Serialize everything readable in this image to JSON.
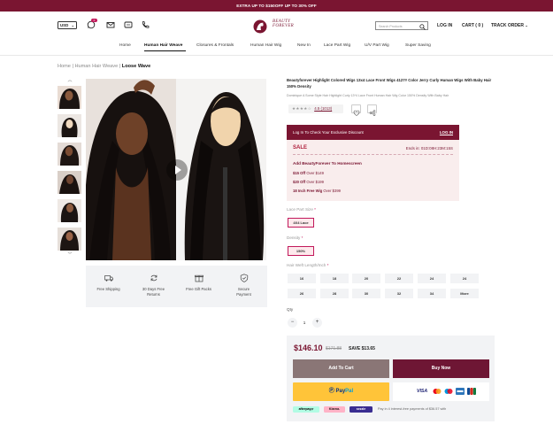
{
  "promo": "EXTRA UP TO $150OFF UP TO 30% OFF",
  "header": {
    "currency": "USD",
    "wishlist_count": "0",
    "logo_line1": "BEAUTY",
    "logo_line2": "FOREVER",
    "search_placeholder": "Search Products",
    "login": "LOG IN",
    "cart": "CART ( 0 )",
    "track": "TRACK ORDER"
  },
  "nav": [
    "Home",
    "Human Hair Weave",
    "Closures & Frontals",
    "Human Hair Wig",
    "New In",
    "Lace Part Wig",
    "U/V Part Wig",
    "Super Saving"
  ],
  "breadcrumb": {
    "home": "Home",
    "sep1": "|",
    "section": "Human Hair Weave",
    "sep2": "|",
    "current": "Loose Wave"
  },
  "features": [
    "Free Shipping",
    "30 Days Free Returns",
    "Free Gift Packs",
    "Secure Payment"
  ],
  "product": {
    "title": "Beautyforever Highlight Colored Wigs 13x4 Lace Front Wigs 4127# Color Jerry Curly Human Wigs With Baby Hair 150% Density",
    "subtitle": "Dominique A Some Style Hair Highlight Curly 13*4 Lace Front Human Hair Wig Color 150% Density With Baby Hair",
    "rating": "4.5 (1013)",
    "stars": 4.5
  },
  "sale": {
    "login_msg": "Log In To Check Your Exclusive Discount",
    "login_link": "LOG IN",
    "label": "SALE",
    "ends": "Ends in: 01D:08H:23M:15S",
    "add_title": "Add BeautyForever To Homescreen",
    "offers": [
      {
        "amount": "$15 Off",
        "cond": "Over $149"
      },
      {
        "amount": "$20 Off",
        "cond": "Over $199"
      },
      {
        "amount": "18 Inch Free Wig",
        "cond": "Over $399"
      }
    ]
  },
  "options": {
    "lace_label": "Lace Part Size",
    "lace_value": "4X4 Lace",
    "density_label": "Density",
    "density_value": "150%",
    "length_label": "Hair Weft Length/Inch",
    "lengths": [
      "16",
      "18",
      "20",
      "22",
      "24",
      "24",
      "26",
      "28",
      "30",
      "32",
      "34",
      "More"
    ],
    "qty_label": "Qty",
    "qty": "1",
    "minus": "−",
    "plus": "+"
  },
  "buy": {
    "price": "$146.10",
    "old_price": "$171.88",
    "save": "SAVE $13.65",
    "add_to_cart": "Add To Cart",
    "buy_now": "Buy Now",
    "paypal_a": "Pay",
    "paypal_b": "Pal",
    "visa": "VISA",
    "bnpl": [
      "afterpay⥂",
      "Klarna.",
      "sezzle"
    ],
    "bnpl_text": "Pay in 4 interest-free payments of $36.57 with"
  }
}
